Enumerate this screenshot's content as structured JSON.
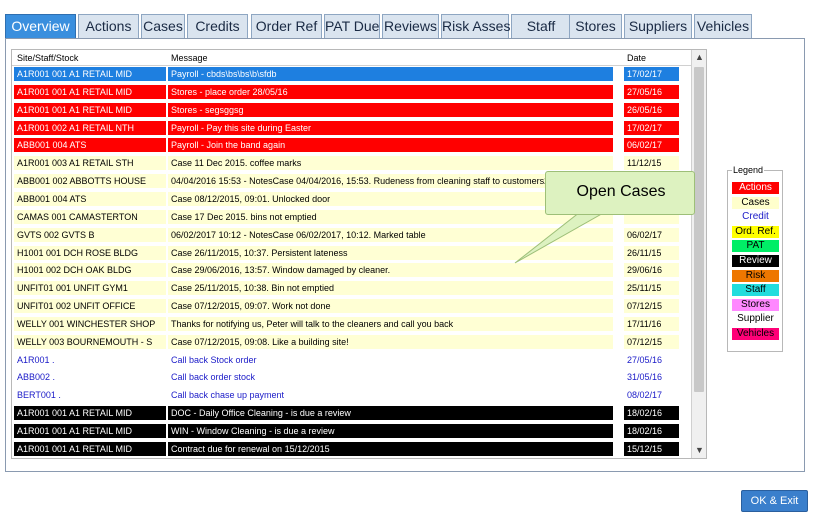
{
  "tabs": [
    {
      "label": "Overview",
      "active": true
    },
    {
      "label": "Actions"
    },
    {
      "label": "Cases"
    },
    {
      "label": "Credits"
    },
    {
      "label": "Order Ref"
    },
    {
      "label": "PAT Due"
    },
    {
      "label": "Reviews"
    },
    {
      "label": "Risk Asses."
    },
    {
      "label": "Staff"
    },
    {
      "label": "Stores"
    },
    {
      "label": "Suppliers"
    },
    {
      "label": "Vehicles"
    }
  ],
  "grid": {
    "headers": {
      "site": "Site/Staff/Stock",
      "message": "Message",
      "date": "Date"
    },
    "rows": [
      {
        "site": "A1R001 001  A1 RETAIL MID",
        "message": "Payroll - cbds\\bs\\bs\\b\\sfdb",
        "date": "17/02/17",
        "type": "selected"
      },
      {
        "site": "A1R001 001  A1 RETAIL MID",
        "message": "Stores - place order 28/05/16",
        "date": "27/05/16",
        "type": "actions"
      },
      {
        "site": "A1R001 001  A1 RETAIL MID",
        "message": "Stores - segsggsg",
        "date": "26/05/16",
        "type": "actions"
      },
      {
        "site": "A1R001 002  A1 RETAIL NTH",
        "message": "Payroll - Pay this site during Easter",
        "date": "17/02/17",
        "type": "actions"
      },
      {
        "site": "ABB001 004  ATS",
        "message": "Payroll - Join the band again",
        "date": "06/02/17",
        "type": "actions"
      },
      {
        "site": "A1R001 003  A1 RETAIL STH",
        "message": "Case 11 Dec 2015. coffee marks",
        "date": "11/12/15",
        "type": "cases"
      },
      {
        "site": "ABB001 002  ABBOTTS HOUSE",
        "message": "04/04/2016 15:53 - NotesCase 04/04/2016, 15:53. Rudeness from cleaning staff to customers29/0",
        "date": "",
        "type": "cases"
      },
      {
        "site": "ABB001 004  ATS",
        "message": "Case 08/12/2015, 09:01. Unlocked door",
        "date": "",
        "type": "cases"
      },
      {
        "site": "CAMAS 001  CAMASTERTON",
        "message": "Case 17 Dec 2015. bins not emptied",
        "date": "",
        "type": "cases"
      },
      {
        "site": "GVTS 002  GVTS B",
        "message": "06/02/2017 10:12 - NotesCase 06/02/2017, 10:12. Marked table",
        "date": "06/02/17",
        "type": "cases"
      },
      {
        "site": "H1001 001  DCH ROSE BLDG",
        "message": "Case 26/11/2015, 10:37.  Persistent lateness",
        "date": "26/11/15",
        "type": "cases"
      },
      {
        "site": "H1001 002  DCH OAK BLDG",
        "message": "Case 29/06/2016, 13:57. Window damaged by cleaner.",
        "date": "29/06/16",
        "type": "cases"
      },
      {
        "site": "UNFIT01 001  UNFIT GYM1",
        "message": "Case 25/11/2015, 10:38. Bin not emptied",
        "date": "25/11/15",
        "type": "cases"
      },
      {
        "site": "UNFIT01 002  UNFIT OFFICE",
        "message": "Case 07/12/2015, 09:07. Work not done",
        "date": "07/12/15",
        "type": "cases"
      },
      {
        "site": "WELLY 001  WINCHESTER SHOP",
        "message": "Thanks for notifying us, Peter will talk to the cleaners and call you back",
        "date": "17/11/16",
        "type": "cases"
      },
      {
        "site": "WELLY 003  BOURNEMOUTH - S",
        "message": "Case 07/12/2015, 09:08. Like a building site!",
        "date": "07/12/15",
        "type": "cases"
      },
      {
        "site": "A1R001  .",
        "message": "Call back Stock order",
        "date": "27/05/16",
        "type": "credit"
      },
      {
        "site": "ABB002  .",
        "message": "Call back order stock",
        "date": "31/05/16",
        "type": "credit"
      },
      {
        "site": "BERT001  .",
        "message": "Call back chase up payment",
        "date": "08/02/17",
        "type": "credit"
      },
      {
        "site": "A1R001 001  A1 RETAIL MID",
        "message": "DOC - Daily Office Cleaning - is due a review",
        "date": "18/02/16",
        "type": "review"
      },
      {
        "site": "A1R001 001  A1 RETAIL MID",
        "message": "WIN - Window Cleaning - is due a review",
        "date": "18/02/16",
        "type": "review"
      },
      {
        "site": "A1R001 001  A1 RETAIL MID",
        "message": "Contract due for renewal on 15/12/2015",
        "date": "15/12/15",
        "type": "review"
      }
    ]
  },
  "callout": {
    "text": "Open Cases"
  },
  "legend": {
    "title": "Legend",
    "items": [
      {
        "label": "Actions",
        "bg": "#ff0000",
        "fg": "#ffffff"
      },
      {
        "label": "Cases",
        "bg": "#ffffcc",
        "fg": "#000000"
      },
      {
        "label": "Credit",
        "bg": "#ffffff",
        "fg": "#1a1ac8"
      },
      {
        "label": "Ord. Ref.",
        "bg": "#ffff00",
        "fg": "#000000"
      },
      {
        "label": "PAT",
        "bg": "#00ee66",
        "fg": "#000000"
      },
      {
        "label": "Review",
        "bg": "#000000",
        "fg": "#ffffff"
      },
      {
        "label": "Risk",
        "bg": "#ee7700",
        "fg": "#000000"
      },
      {
        "label": "Staff",
        "bg": "#22dddd",
        "fg": "#000000"
      },
      {
        "label": "Stores",
        "bg": "#ff88ff",
        "fg": "#000000"
      },
      {
        "label": "Supplier",
        "bg": "#ffffff",
        "fg": "#000000"
      },
      {
        "label": "Vehicles",
        "bg": "#ff0077",
        "fg": "#000000"
      }
    ]
  },
  "row_colors": {
    "selected": {
      "bg": "#1e7fe0",
      "fg": "#ffffff"
    },
    "actions": {
      "bg": "#ff0000",
      "fg": "#ffffff"
    },
    "cases": {
      "bg": "#ffffd4",
      "fg": "#000000"
    },
    "credit": {
      "bg": "#ffffff",
      "fg": "#1a1ac8"
    },
    "review": {
      "bg": "#000000",
      "fg": "#ffffff"
    }
  },
  "ok_button": {
    "label": "OK & Exit"
  }
}
